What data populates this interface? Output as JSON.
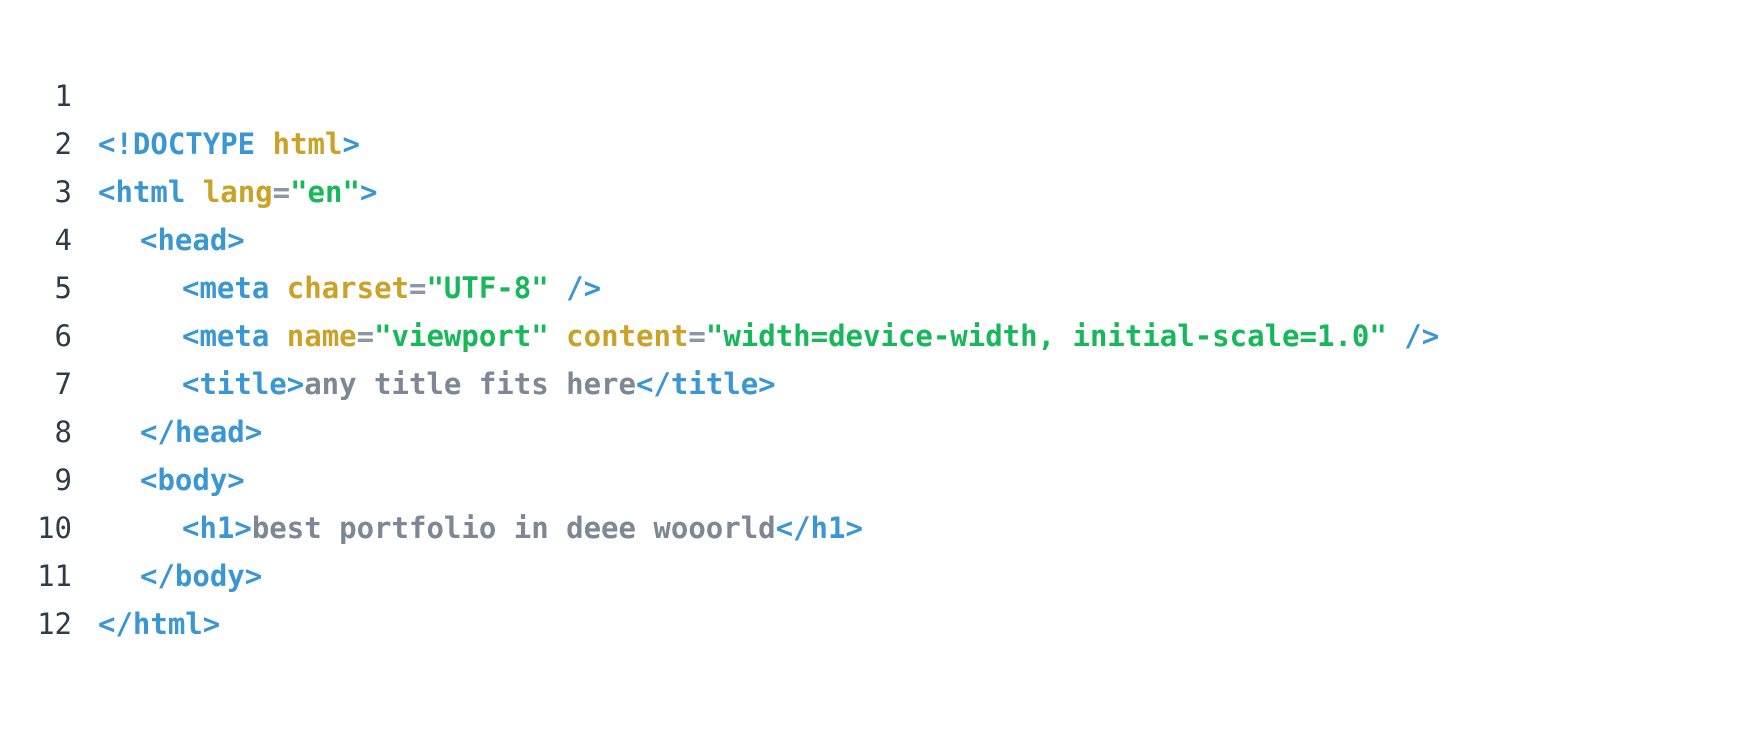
{
  "line_numbers": [
    "1",
    "2",
    "3",
    "4",
    "5",
    "6",
    "7",
    "8",
    "9",
    "10",
    "11",
    "12"
  ],
  "lines": {
    "l1": {
      "open": "<!DOCTYPE",
      "kw": "html",
      "close": ">"
    },
    "l2": {
      "open": "<html",
      "attr": "lang",
      "eq": "=",
      "val": "\"en\"",
      "close": ">"
    },
    "l3": {
      "tag": "<head>"
    },
    "l4": {
      "open": "<meta",
      "attr": "charset",
      "eq": "=",
      "val": "\"UTF-8\"",
      "close": "/>"
    },
    "l5": {
      "open": "<meta",
      "attr1": "name",
      "eq1": "=",
      "val1": "\"viewport\"",
      "attr2": "content",
      "eq2": "=",
      "val2": "\"width=device-width, initial-scale=1.0\"",
      "close": "/>"
    },
    "l6": {
      "open": "<title>",
      "text": "any title fits here",
      "close": "</title>"
    },
    "l7": {
      "tag": "</head>"
    },
    "l8": {
      "tag": "<body>"
    },
    "l9": {
      "open": "<h1>",
      "text": "best portfolio in deee wooorld",
      "close": "</h1>"
    },
    "l10": {
      "tag": "</body>"
    },
    "l11": {
      "tag": "</html>"
    }
  },
  "colors": {
    "tag": "#3a97d4",
    "attribute": "#c9a227",
    "string": "#17b85a",
    "text": "#7d8796",
    "line_number": "#2f3b47",
    "background": "#ffffff"
  }
}
